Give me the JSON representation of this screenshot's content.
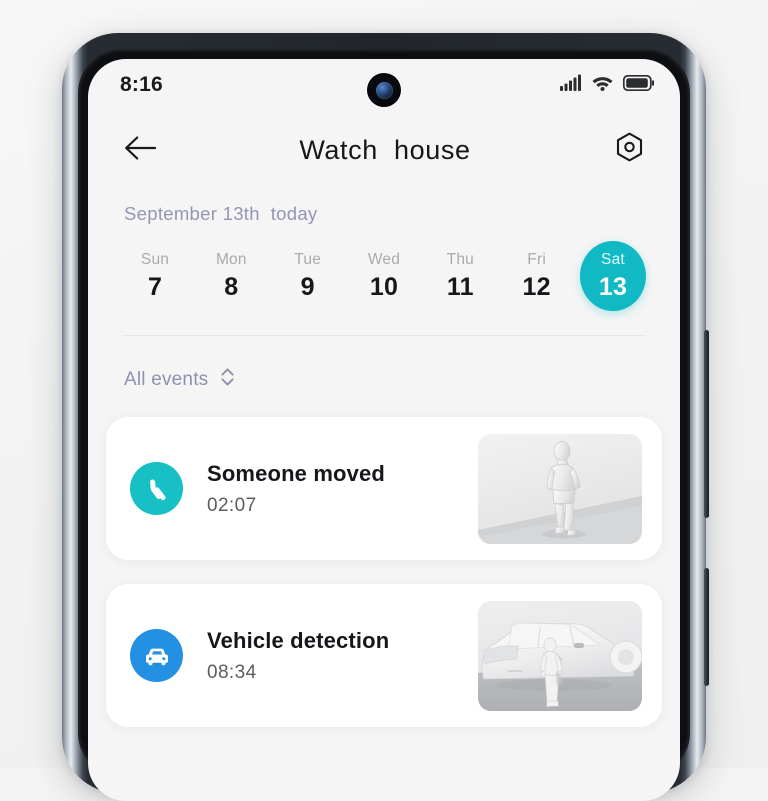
{
  "status_bar": {
    "time": "8:16",
    "icons": [
      "signal-bars-icon",
      "wifi-icon",
      "battery-icon"
    ]
  },
  "header": {
    "back_icon": "back-arrow-icon",
    "title": "Watch  house",
    "settings_icon": "settings-hex-icon"
  },
  "date_section": {
    "caption": "September 13th  today",
    "days": [
      {
        "dow": "Sun",
        "dom": "7",
        "selected": false
      },
      {
        "dow": "Mon",
        "dom": "8",
        "selected": false
      },
      {
        "dow": "Tue",
        "dom": "9",
        "selected": false
      },
      {
        "dow": "Wed",
        "dom": "10",
        "selected": false
      },
      {
        "dow": "Thu",
        "dom": "11",
        "selected": false
      },
      {
        "dow": "Fri",
        "dom": "12",
        "selected": false
      },
      {
        "dow": "Sat",
        "dom": "13",
        "selected": true
      }
    ]
  },
  "filter": {
    "label": "All events",
    "icon": "sort-chevrons-icon"
  },
  "events": [
    {
      "title": "Someone moved",
      "time": "02:07",
      "icon": "walking-person-icon",
      "icon_color": "#16c0c4",
      "thumbnail": "person-walking-thumbnail"
    },
    {
      "title": "Vehicle detection",
      "time": "08:34",
      "icon": "car-front-icon",
      "icon_color": "#2490e4",
      "thumbnail": "car-with-person-thumbnail"
    }
  ],
  "colors": {
    "accent_teal": "#11b9c4",
    "accent_blue": "#2490e4",
    "screen_bg": "#f5f5f5",
    "card_bg": "#ffffff",
    "muted_text": "#9396b4",
    "page_bg": "#f4f4f4"
  }
}
